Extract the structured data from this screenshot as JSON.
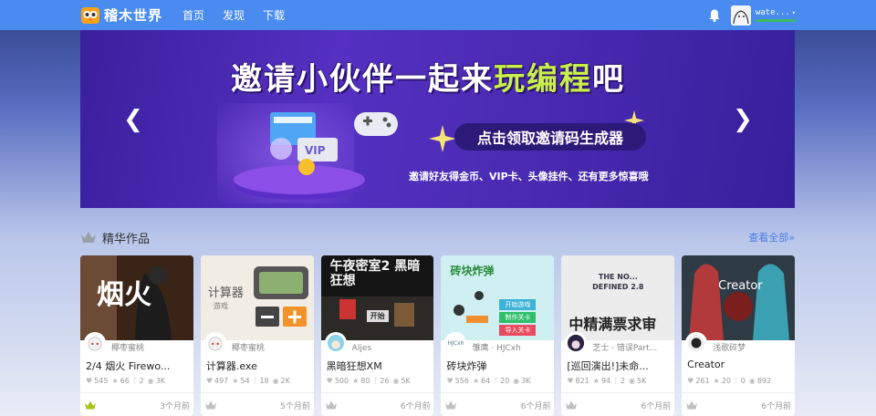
{
  "app": {
    "brand": "稽木世界",
    "nav": [
      "首页",
      "发现",
      "下载"
    ],
    "username": "wate...",
    "caret": "▾"
  },
  "banner": {
    "title_part1": "邀请小伙伴一起来",
    "title_hl": "玩编程",
    "title_part2": "吧",
    "pill": "点击领取邀请码生成器",
    "subtitle": "邀请好友得金币、VIP卡、头像挂件、还有更多惊喜哦",
    "prev": "❮",
    "next": "❯",
    "vip_label": "VIP"
  },
  "section": {
    "title": "精华作品",
    "see_all": "查看全部»"
  },
  "cards": [
    {
      "author": "椰枣蜜桃",
      "title": "2/4 烟火 Firewo...",
      "views": "545",
      "likes": "66",
      "forks": "2",
      "watch": "3K",
      "time": "3个月前",
      "thumb_text": "烟火",
      "thumb_bg": "#2a2a2a",
      "crown": "#a8c520"
    },
    {
      "author": "椰枣蜜桃",
      "title": "计算器.exe",
      "views": "497",
      "likes": "54",
      "forks": "18",
      "watch": "2K",
      "time": "5个月前",
      "thumb_text": "计算器",
      "thumb_sub": "游戏",
      "thumb_bg": "#f2ede4",
      "crown": "#c0c0c0"
    },
    {
      "author": "Aljes",
      "title": "黑暗狂想XM",
      "views": "500",
      "likes": "80",
      "forks": "26",
      "watch": "5K",
      "time": "6个月前",
      "thumb_text": "午夜密室2 黑暗狂想",
      "thumb_btn": "开始",
      "thumb_bg": "#111111",
      "crown": "#c0c0c0"
    },
    {
      "author": "雏鹰 · HJCxh",
      "title": "砖块炸弹",
      "views": "556",
      "likes": "64",
      "forks": "20",
      "watch": "3K",
      "time": "6个月前",
      "thumb_text": "砖块炸弹",
      "thumb_btns": [
        "开始游戏",
        "制作关卡",
        "导入关卡"
      ],
      "thumb_bg": "#cfeff2",
      "av_text": "HJCxh",
      "crown": "#c0c0c0"
    },
    {
      "author": "芝士 · 错误Part...",
      "title": "[巡回演出!]未命...",
      "views": "821",
      "likes": "94",
      "forks": "2",
      "watch": "5K",
      "time": "6个月前",
      "thumb_text": "中精满票求审",
      "thumb_top": "THE NO... DEFINED 2.8",
      "thumb_bg": "#ececec",
      "crown": "#c0c0c0"
    },
    {
      "author": "浅歌碎梦",
      "title": "Creator",
      "views": "261",
      "likes": "20",
      "forks": "0",
      "watch": "892",
      "time": "6个月前",
      "thumb_text": "Creator",
      "thumb_bg": "#2b3a44",
      "crown": "#c0c0c0"
    }
  ]
}
